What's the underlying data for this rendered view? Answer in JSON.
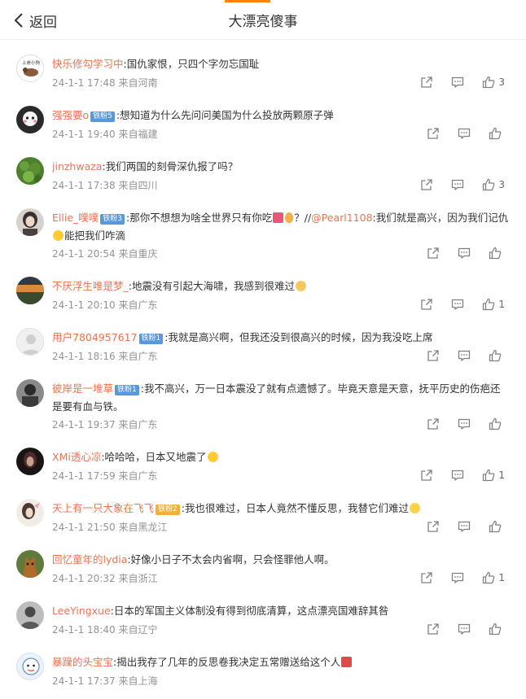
{
  "header": {
    "back_label": "返回",
    "title": "大漂亮傻事"
  },
  "comments": [
    {
      "user": "快乐修勾学习中",
      "sep": ":",
      "text": "国仇家恨，只四个字勿忘国耻",
      "time": "24-1-1 17:48",
      "source": "来自河南",
      "likes": "3",
      "avatar_label": "上岸小狗"
    },
    {
      "user": "强强要o",
      "badge": "铁粉5",
      "sep": ":",
      "text": "想知道为什么先问问美国为什么投放两颗原子弹",
      "time": "24-1-1 19:40",
      "source": "来自福建",
      "likes": ""
    },
    {
      "user": "jinzhwaza",
      "sep": ":",
      "text": "我们两国的刻骨深仇报了吗？",
      "time": "24-1-1 17:38",
      "source": "来自四川",
      "likes": "3"
    },
    {
      "user": "Ellie_噗噗",
      "badge": "铁粉3",
      "sep": ":",
      "text": "那你不想想为啥全世界只有你吃",
      "text2": "？//",
      "mention": "@Pearl1108",
      "text3": ":我们就是高兴，因为我们记仇",
      "text4": "能把我们咋滴",
      "time": "24-1-1 20:54",
      "source": "来自重庆",
      "likes": ""
    },
    {
      "user": "不厌浮生唯是梦_",
      "sep": ":",
      "text": "地震没有引起大海啸，我感到很难过",
      "time": "24-1-1 20:10",
      "source": "来自广东",
      "likes": "1"
    },
    {
      "user": "用户7804957617",
      "badge": "铁粉1",
      "sep": ":",
      "text": "我就是高兴啊，但我还没到很高兴的时候，因为我没吃上席",
      "time": "24-1-1 18:16",
      "source": "来自广东",
      "likes": ""
    },
    {
      "user": "彼岸是一堆草",
      "badge": "铁粉1",
      "sep": ":",
      "text": "我不高兴，万一日本震没了就有点遗憾了。毕竟天意是天意，抚平历史的伤疤还是要有血与铁。",
      "time": "24-1-1 19:37",
      "source": "来自广东",
      "likes": ""
    },
    {
      "user": "XMi透心凉",
      "sep": ":",
      "text": "哈哈哈，日本又地震了",
      "time": "24-1-1 17:59",
      "source": "来自广东",
      "likes": "1"
    },
    {
      "user": "天上有一只大象在飞飞",
      "badge": "铁粉2",
      "sep": ":",
      "text": "我也很难过，日本人竟然不懂反思，我替它们难过",
      "time": "24-1-1 21:50",
      "source": "来自黑龙江",
      "likes": ""
    },
    {
      "user": "回忆童年的lydia",
      "sep": ":",
      "text": "好像小日子不太会内省啊，只会怪罪他人啊。",
      "time": "24-1-1 20:32",
      "source": "来自浙江",
      "likes": "1"
    },
    {
      "user": "LeeYingxue",
      "sep": ":",
      "text": "日本的军国主义体制没有得到彻底清算，这点漂亮国难辞其咎",
      "time": "24-1-1 18:40",
      "source": "来自辽宁",
      "likes": ""
    },
    {
      "user": "暴躁的头宝宝",
      "sep": ":",
      "text": "揭出我存了几年的反思卷我决定五常赠送给这个人",
      "time": "24-1-1 17:37",
      "source": "来自上海",
      "likes": ""
    }
  ],
  "icons": [
    "chevron-left-icon",
    "share-icon",
    "comment-icon",
    "like-icon"
  ],
  "colors": {
    "username": "#eb7350",
    "meta": "#939393",
    "accent": "#ff8200",
    "badge": "#5a98de"
  }
}
